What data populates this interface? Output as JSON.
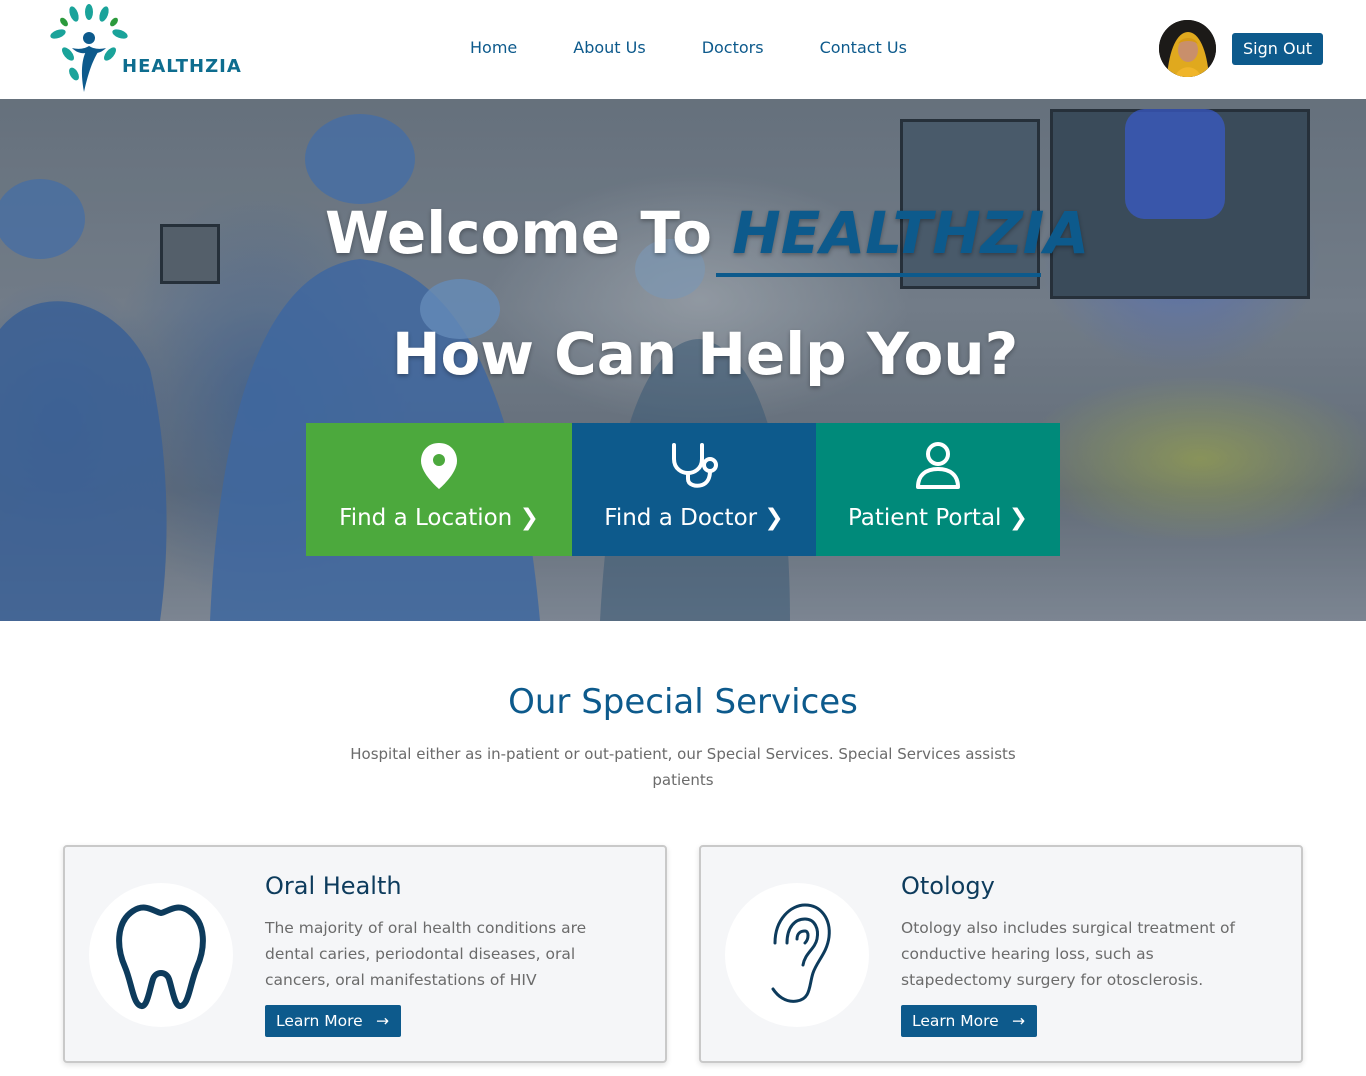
{
  "header": {
    "logo_text": "HEALTHZIA",
    "nav": [
      "Home",
      "About Us",
      "Doctors",
      "Contact Us"
    ],
    "signout_label": "Sign Out"
  },
  "hero": {
    "welcome_prefix": "Welcome To ",
    "welcome_brand": "HEALTHZIA",
    "question": "How Can Help You?",
    "tiles": [
      {
        "label": "Find a Location",
        "icon": "location-pin-icon",
        "color": "#4ca93d"
      },
      {
        "label": "Find a Doctor",
        "icon": "stethoscope-icon",
        "color": "#0d5a8c"
      },
      {
        "label": "Patient Portal",
        "icon": "user-icon",
        "color": "#008a7a"
      }
    ]
  },
  "services": {
    "title": "Our Special Services",
    "subtitle": "Hospital either as in-patient or out-patient, our Special Services. Special Services assists patients",
    "cards": [
      {
        "title": "Oral Health",
        "text": "The majority of oral health conditions are dental caries, periodontal diseases, oral cancers, oral manifestations of HIV",
        "button": "Learn More",
        "icon": "tooth-icon"
      },
      {
        "title": "Otology",
        "text": "Otology also includes surgical treatment of conductive hearing loss, such as stapedectomy surgery for otosclerosis.",
        "button": "Learn More",
        "icon": "ear-icon"
      }
    ]
  },
  "colors": {
    "primary": "#0d5a8c",
    "green": "#4ca93d",
    "teal": "#008a7a"
  }
}
